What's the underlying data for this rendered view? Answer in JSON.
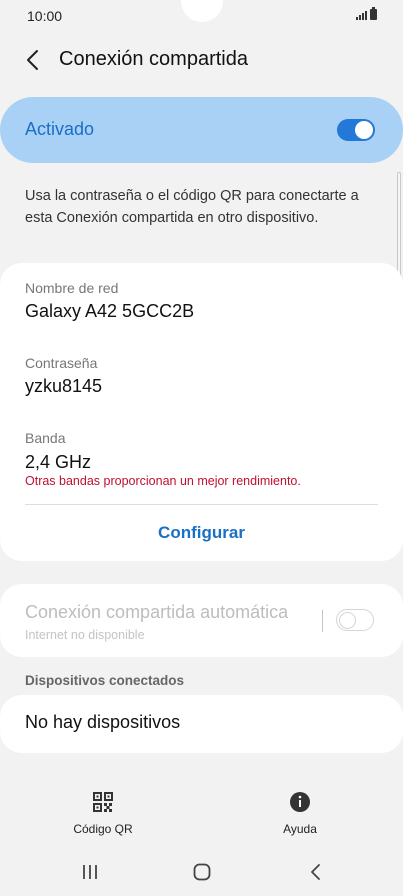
{
  "status_bar": {
    "time": "10:00"
  },
  "header": {
    "title": "Conexión compartida"
  },
  "main_toggle": {
    "label": "Activado",
    "state": "on"
  },
  "description": "Usa la contraseña o el código QR para conectarte a esta Conexión compartida en otro dispositivo.",
  "network": {
    "name_label": "Nombre de red",
    "name_value": "Galaxy A42 5GCC2B",
    "password_label": "Contraseña",
    "password_value": "yzku8145",
    "band_label": "Banda",
    "band_value": "2,4 GHz",
    "band_note": "Otras bandas proporcionan un mejor rendimiento.",
    "configure_label": "Configurar"
  },
  "auto_hotspot": {
    "title": "Conexión compartida automática",
    "subtitle": "Internet no disponible",
    "state": "off"
  },
  "connected_devices": {
    "section_label": "Dispositivos conectados",
    "empty_text": "No hay dispositivos"
  },
  "bottom_actions": {
    "qr_label": "Código QR",
    "help_label": "Ayuda"
  },
  "colors": {
    "accent": "#1a6fc6",
    "toggle_card_bg": "#a9d1f6",
    "warning": "#c01030",
    "background": "#f2f2f2"
  },
  "icons": [
    "back-icon",
    "signal-icon",
    "battery-icon",
    "qr-code-icon",
    "info-icon",
    "recent-apps-icon",
    "home-icon",
    "back-nav-icon"
  ]
}
